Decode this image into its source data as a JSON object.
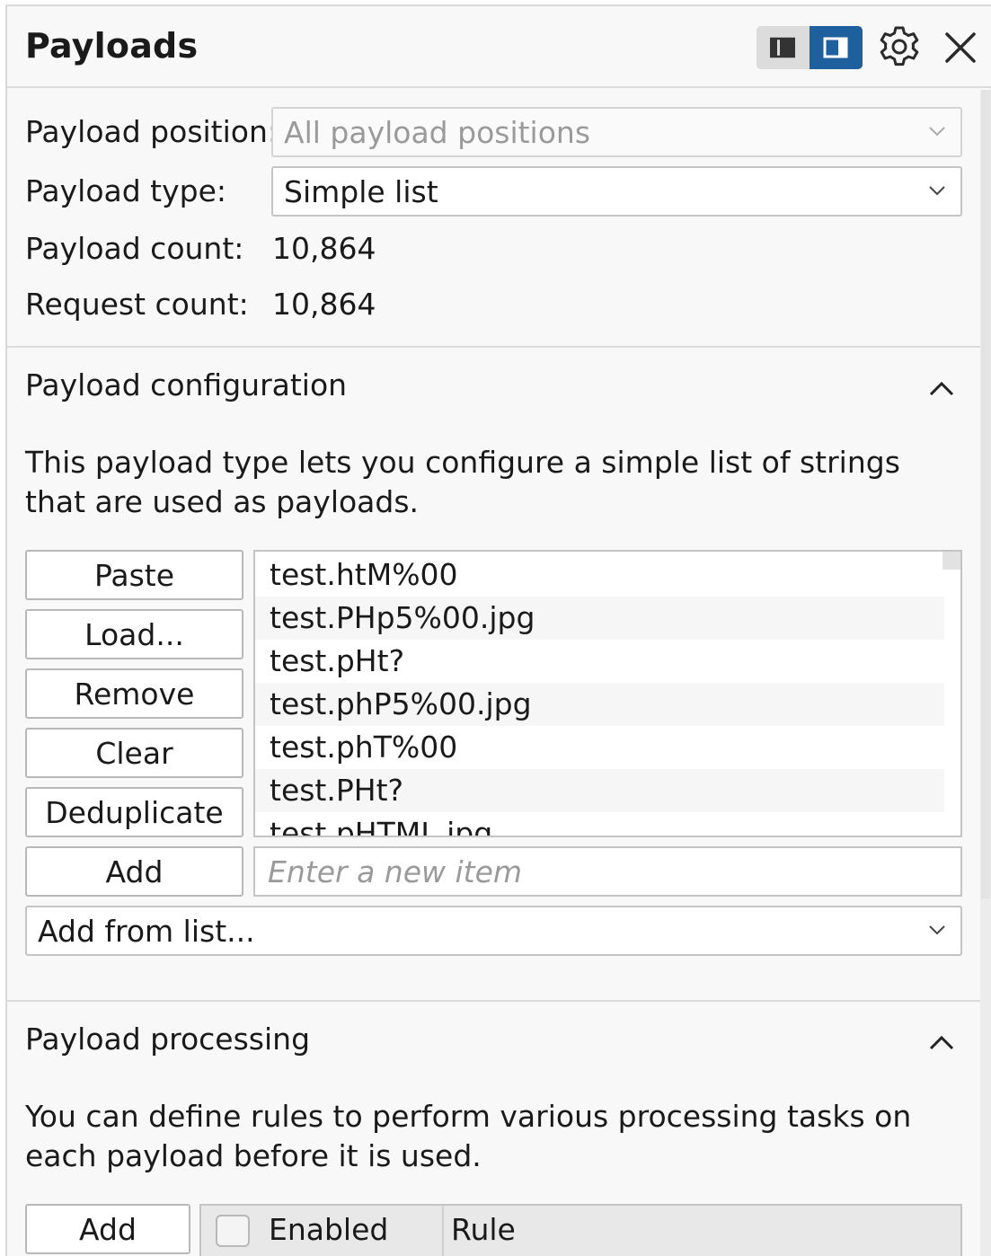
{
  "header": {
    "title": "Payloads"
  },
  "settings": {
    "position_label": "Payload position:",
    "position_value": "All payload positions",
    "type_label": "Payload type:",
    "type_value": "Simple list",
    "payload_count_label": "Payload count:",
    "payload_count": "10,864",
    "request_count_label": "Request count:",
    "request_count": "10,864"
  },
  "configuration": {
    "title": "Payload configuration",
    "description": "This payload type lets you configure a simple list of strings that are used as payloads.",
    "buttons": {
      "paste": "Paste",
      "load": "Load...",
      "remove": "Remove",
      "clear": "Clear",
      "deduplicate": "Deduplicate",
      "add": "Add"
    },
    "items": [
      "test.htM%00",
      "test.PHp5%00.jpg",
      "test.pHt?",
      "test.phP5%00.jpg",
      "test.phT%00",
      "test.PHt?",
      "test.pHTML.jpg"
    ],
    "new_item_placeholder": "Enter a new item",
    "add_from_list": "Add from list..."
  },
  "processing": {
    "title": "Payload processing",
    "description": "You can define rules to perform various processing tasks on each payload before it is used.",
    "add_button": "Add",
    "columns": {
      "enabled": "Enabled",
      "rule": "Rule"
    }
  },
  "colors": {
    "accent": "#1e5f9e",
    "panel_bg": "#f8f8f8",
    "border": "#c4c4c4"
  },
  "icons": [
    "sidebar-layout-icon",
    "panel-layout-icon",
    "gear-icon",
    "close-icon",
    "chevron-down-icon",
    "chevron-up-icon"
  ]
}
